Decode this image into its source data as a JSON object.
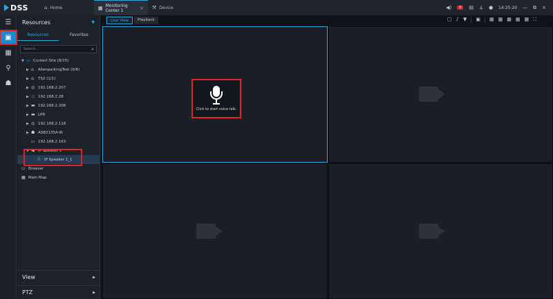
{
  "titlebar": {
    "brand": "DSS",
    "tabs": [
      {
        "label": "Home",
        "icon": "home-icon"
      },
      {
        "label": "Monitoring Center 1",
        "icon": "grid-icon",
        "close": "×"
      },
      {
        "label": "Device",
        "icon": "wrench-icon"
      }
    ],
    "alarm_count": "0",
    "time": "14:25:20",
    "window_controls": [
      "—",
      "⧉",
      "×"
    ]
  },
  "rail": {
    "menu_icon": "☰",
    "items": [
      "monitor-icon",
      "grid-icon",
      "map-icon",
      "person-icon"
    ]
  },
  "panel": {
    "title": "Resources",
    "tabs": [
      "Resources",
      "Favorites"
    ],
    "search_placeholder": "Search...",
    "tree": [
      {
        "label": "Current Site (8/15)",
        "level": 0,
        "arrow": "▼",
        "icon": "site-icon"
      },
      {
        "label": "AllenparkingTest (0/6)",
        "level": 1,
        "arrow": "▶",
        "icon": "org-icon"
      },
      {
        "label": "TS2 (1/1)",
        "level": 1,
        "arrow": "▶",
        "icon": "org-icon"
      },
      {
        "label": "192.168.2.207",
        "level": 1,
        "arrow": "▶",
        "icon": "camera-icon"
      },
      {
        "label": "192.168.2.28",
        "level": 1,
        "arrow": "▶",
        "icon": "alert-camera-icon"
      },
      {
        "label": "192.168.2.206",
        "level": 1,
        "arrow": "▶",
        "icon": "nvr-icon"
      },
      {
        "label": "LPR",
        "level": 1,
        "arrow": "▶",
        "icon": "nvr-icon"
      },
      {
        "label": "192.168.2.118",
        "level": 1,
        "arrow": "▶",
        "icon": "camera-icon"
      },
      {
        "label": "ASB2135A-W",
        "level": 1,
        "arrow": "▶",
        "icon": "person-icon"
      },
      {
        "label": "192.168.2.163",
        "level": 1,
        "arrow": "",
        "icon": "screen-icon"
      },
      {
        "label": "IP Speaker 1",
        "level": 1,
        "arrow": "▼",
        "icon": "speaker-icon"
      },
      {
        "label": "IP Speaker 1_1",
        "level": 2,
        "arrow": "",
        "icon": "mic-icon"
      },
      {
        "label": "Browser",
        "level": 0,
        "arrow": "",
        "icon": "browser-icon"
      },
      {
        "label": "Main Map",
        "level": 0,
        "arrow": "",
        "icon": "map-icon"
      }
    ],
    "bottom": [
      {
        "label": "View"
      },
      {
        "label": "PTZ"
      }
    ]
  },
  "main": {
    "tabs": [
      "Live View",
      "Playback"
    ],
    "voice_text": "Click to start voice talk."
  }
}
